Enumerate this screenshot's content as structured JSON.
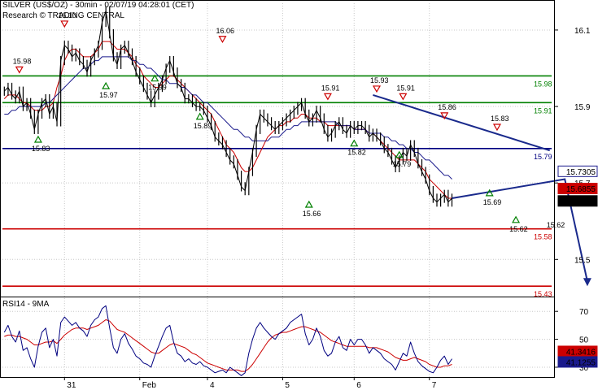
{
  "header": {
    "title": "SILVER (US$/OZ) - 30min - 02/07/19 04:28:01 (CET)",
    "research": "Research © TRADING CENTRAL"
  },
  "colors": {
    "price": "#000000",
    "ma_fast": "#cc0000",
    "ma_slow": "#1a1a8c",
    "support_resistance_green": "#008000",
    "pivot_blue": "#000080",
    "support_red": "#cc0000",
    "trend_arrow": "#1a2a8c",
    "rsi": "#000080",
    "rsi_ma": "#cc0000"
  },
  "chart_data": [
    {
      "type": "line",
      "panel": "price",
      "ylim": [
        15.405,
        16.17
      ],
      "yticks": [
        16.1,
        15.9,
        15.7,
        15.5
      ],
      "x_labels": [
        {
          "label": "31",
          "bar": 16
        },
        {
          "label": "Feb",
          "bar": 36
        },
        {
          "label": "4",
          "bar": 54
        },
        {
          "label": "5",
          "bar": 74
        },
        {
          "label": "6",
          "bar": 93
        },
        {
          "label": "7",
          "bar": 113
        }
      ],
      "bars_total": 146,
      "series": [
        {
          "role": "price",
          "values": [
            15.94,
            15.95,
            15.93,
            15.92,
            15.94,
            15.9,
            15.91,
            15.88,
            15.84,
            15.88,
            15.91,
            15.92,
            15.88,
            15.9,
            15.86,
            16.02,
            16.06,
            16.05,
            16.03,
            16.04,
            16.02,
            16.01,
            15.99,
            16.02,
            16.04,
            16.06,
            16.12,
            16.15,
            16.09,
            16.03,
            16.01,
            16.05,
            16.06,
            16.04,
            16.02,
            15.99,
            15.97,
            15.95,
            15.93,
            15.91,
            15.93,
            15.95,
            15.97,
            16.0,
            16.02,
            15.99,
            15.96,
            15.95,
            15.92,
            15.92,
            15.91,
            15.9,
            15.9,
            15.89,
            15.87,
            15.85,
            15.82,
            15.81,
            15.8,
            15.78,
            15.76,
            15.75,
            15.72,
            15.69,
            15.68,
            15.73,
            15.78,
            15.84,
            15.88,
            15.87,
            15.86,
            15.85,
            15.84,
            15.85,
            15.86,
            15.87,
            15.88,
            15.89,
            15.9,
            15.91,
            15.88,
            15.86,
            15.87,
            15.89,
            15.87,
            15.84,
            15.82,
            15.83,
            15.85,
            15.86,
            15.84,
            15.83,
            15.85,
            15.84,
            15.85,
            15.85,
            15.84,
            15.82,
            15.83,
            15.82,
            15.81,
            15.79,
            15.78,
            15.76,
            15.74,
            15.76,
            15.78,
            15.77,
            15.8,
            15.78,
            15.75,
            15.73,
            15.71,
            15.68,
            15.66,
            15.65,
            15.66,
            15.67,
            15.65,
            15.66
          ]
        },
        {
          "role": "ma_fast",
          "values": [
            15.92,
            15.93,
            15.93,
            15.93,
            15.92,
            15.91,
            15.91,
            15.9,
            15.89,
            15.89,
            15.89,
            15.9,
            15.9,
            15.91,
            15.95,
            15.98,
            16.02,
            16.04,
            16.05,
            16.05,
            16.04,
            16.03,
            16.03,
            16.03,
            16.04,
            16.05,
            16.07,
            16.07,
            16.07,
            16.06,
            16.05,
            16.05,
            16.05,
            16.04,
            16.03,
            16.01,
            16.0,
            15.98,
            15.97,
            15.96,
            15.95,
            15.95,
            15.96,
            15.97,
            15.98,
            15.98,
            15.97,
            15.96,
            15.95,
            15.94,
            15.93,
            15.92,
            15.91,
            15.9,
            15.89,
            15.88,
            15.86,
            15.84,
            15.82,
            15.8,
            15.79,
            15.78,
            15.76,
            15.74,
            15.73,
            15.73,
            15.74,
            15.76,
            15.78,
            15.8,
            15.82,
            15.83,
            15.84,
            15.85,
            15.85,
            15.86,
            15.86,
            15.87,
            15.87,
            15.88,
            15.88,
            15.87,
            15.87,
            15.87,
            15.86,
            15.86,
            15.85,
            15.85,
            15.85,
            15.85,
            15.85,
            15.85,
            15.85,
            15.84,
            15.84,
            15.84,
            15.84,
            15.83,
            15.83,
            15.82,
            15.81,
            15.8,
            15.79,
            15.78,
            15.77,
            15.76,
            15.76,
            15.76,
            15.76,
            15.76,
            15.75,
            15.74,
            15.73,
            15.71,
            15.7,
            15.69,
            15.68,
            15.67,
            15.66,
            15.66
          ]
        },
        {
          "role": "ma_slow",
          "values": [
            15.88,
            15.88,
            15.89,
            15.89,
            15.9,
            15.9,
            15.9,
            15.9,
            15.9,
            15.9,
            15.9,
            15.91,
            15.91,
            15.92,
            15.93,
            15.94,
            15.95,
            15.96,
            15.97,
            15.98,
            15.99,
            16.0,
            16.0,
            16.01,
            16.02,
            16.02,
            16.03,
            16.03,
            16.03,
            16.03,
            16.03,
            16.03,
            16.03,
            16.03,
            16.02,
            16.02,
            16.01,
            16.01,
            16.0,
            16.0,
            15.99,
            15.98,
            15.97,
            15.97,
            15.96,
            15.96,
            15.96,
            15.95,
            15.95,
            15.94,
            15.93,
            15.93,
            15.92,
            15.91,
            15.91,
            15.9,
            15.89,
            15.88,
            15.87,
            15.86,
            15.85,
            15.84,
            15.84,
            15.83,
            15.82,
            15.82,
            15.81,
            15.81,
            15.81,
            15.81,
            15.81,
            15.82,
            15.82,
            15.82,
            15.83,
            15.84,
            15.84,
            15.85,
            15.85,
            15.86,
            15.86,
            15.86,
            15.86,
            15.86,
            15.86,
            15.86,
            15.86,
            15.86,
            15.86,
            15.85,
            15.85,
            15.85,
            15.85,
            15.84,
            15.84,
            15.84,
            15.84,
            15.83,
            15.83,
            15.83,
            15.83,
            15.82,
            15.82,
            15.81,
            15.81,
            15.8,
            15.8,
            15.79,
            15.79,
            15.78,
            15.78,
            15.77,
            15.76,
            15.76,
            15.75,
            15.74,
            15.73,
            15.72,
            15.72,
            15.71
          ]
        }
      ],
      "horizontal_levels": [
        {
          "value": 15.98,
          "label": "15.98",
          "color": "#008000"
        },
        {
          "value": 15.91,
          "label": "15.91",
          "color": "#008000"
        },
        {
          "value": 15.79,
          "label": "15.79",
          "color": "#000080"
        },
        {
          "value": 15.58,
          "label": "15.58",
          "color": "#cc0000"
        },
        {
          "value": 15.43,
          "label": "15.43",
          "color": "#cc0000"
        }
      ],
      "price_tags": [
        {
          "value": 15.7305,
          "label": "15.7305",
          "bg": "#ffffff",
          "fg": "#1a1a8c",
          "border": "#1a1a8c"
        },
        {
          "value": 15.6855,
          "label": "15.6855",
          "bg": "#cc0000",
          "fg": "#ffffff",
          "border": "#cc0000"
        },
        {
          "value": 15.653,
          "label": "15.653",
          "bg": "#000000",
          "fg": "#ffffff",
          "border": "#000000"
        }
      ],
      "pivot_highs": [
        {
          "bar": 4,
          "value": 15.98,
          "label": "15.98"
        },
        {
          "bar": 16,
          "value": 16.1,
          "label": "16.10"
        },
        {
          "bar": 58,
          "value": 16.06,
          "label": "16.06"
        },
        {
          "bar": 86,
          "value": 15.91,
          "label": "15.91"
        },
        {
          "bar": 99,
          "value": 15.93,
          "label": "15.93"
        },
        {
          "bar": 106,
          "value": 15.91,
          "label": "15.91"
        },
        {
          "bar": 117,
          "value": 15.86,
          "label": "15.86"
        },
        {
          "bar": 131,
          "value": 15.83,
          "label": "15.83"
        }
      ],
      "pivot_lows": [
        {
          "bar": 9,
          "value": 15.83,
          "label": "15.83"
        },
        {
          "bar": 27,
          "value": 15.97,
          "label": "15.97"
        },
        {
          "bar": 40,
          "value": 15.99,
          "label": "15.99"
        },
        {
          "bar": 52,
          "value": 15.89,
          "label": "15.89"
        },
        {
          "bar": 81,
          "value": 15.66,
          "label": "15.66"
        },
        {
          "bar": 93,
          "value": 15.82,
          "label": "15.82"
        },
        {
          "bar": 105,
          "value": 15.79,
          "label": "15.79"
        },
        {
          "bar": 129,
          "value": 15.69,
          "label": "15.69"
        },
        {
          "bar": 136,
          "value": 15.62,
          "label": "15.62"
        }
      ],
      "extra_label": {
        "bar": 145,
        "value": 15.6,
        "label": "15.62"
      },
      "trendline": {
        "from": {
          "bar": 98,
          "value": 15.93
        },
        "to": {
          "bar": 145,
          "value": 15.785
        }
      },
      "projection_arrow": [
        {
          "bar": 149,
          "value": 15.71
        },
        {
          "bar": 155,
          "value": 15.43
        }
      ]
    },
    {
      "type": "line",
      "panel": "rsi",
      "title": "RSI14 - 9MA",
      "ylim": [
        23,
        80
      ],
      "yticks": [
        70,
        50,
        30
      ],
      "series": [
        {
          "role": "rsi",
          "values": [
            55,
            60,
            52,
            48,
            56,
            42,
            44,
            36,
            30,
            45,
            55,
            58,
            44,
            50,
            38,
            62,
            66,
            63,
            60,
            62,
            58,
            56,
            52,
            60,
            64,
            66,
            72,
            74,
            58,
            44,
            40,
            50,
            54,
            47,
            43,
            38,
            36,
            33,
            32,
            30,
            38,
            45,
            52,
            58,
            60,
            48,
            40,
            38,
            34,
            36,
            33,
            32,
            34,
            31,
            30,
            28,
            26,
            27,
            28,
            26,
            30,
            28,
            26,
            24,
            26,
            40,
            50,
            58,
            62,
            58,
            55,
            52,
            50,
            54,
            56,
            58,
            62,
            64,
            66,
            68,
            54,
            46,
            50,
            58,
            52,
            42,
            38,
            40,
            48,
            52,
            44,
            42,
            50,
            46,
            50,
            50,
            46,
            40,
            44,
            42,
            40,
            36,
            34,
            32,
            28,
            34,
            40,
            38,
            48,
            40,
            34,
            31,
            29,
            27,
            26,
            30,
            35,
            38,
            32,
            36
          ]
        },
        {
          "role": "rsi_ma",
          "values": [
            52,
            53,
            53,
            52,
            52,
            51,
            50,
            48,
            46,
            46,
            47,
            48,
            48,
            49,
            47,
            50,
            53,
            55,
            57,
            58,
            58,
            58,
            57,
            58,
            59,
            60,
            62,
            64,
            63,
            60,
            57,
            56,
            55,
            53,
            51,
            49,
            47,
            45,
            43,
            41,
            40,
            40,
            42,
            44,
            46,
            47,
            46,
            45,
            44,
            42,
            40,
            39,
            37,
            35,
            33,
            32,
            31,
            30,
            29,
            28,
            28,
            28,
            28,
            27,
            27,
            29,
            32,
            36,
            40,
            44,
            48,
            51,
            53,
            54,
            55,
            55,
            56,
            57,
            58,
            59,
            59,
            58,
            57,
            56,
            55,
            53,
            51,
            49,
            48,
            47,
            46,
            45,
            45,
            45,
            45,
            45,
            45,
            44,
            44,
            44,
            43,
            42,
            41,
            39,
            37,
            36,
            35,
            35,
            36,
            37,
            36,
            35,
            34,
            32,
            31,
            30,
            30,
            31,
            31,
            32
          ]
        }
      ],
      "price_tags": [
        {
          "value": 41.3416,
          "label": "41.3416",
          "bg": "#cc0000",
          "fg": "#ffffff",
          "border": "#cc0000"
        },
        {
          "value": 41.1255,
          "label": "41.1255",
          "bg": "#1a1a8c",
          "fg": "#ffffff",
          "border": "#1a1a8c"
        }
      ]
    }
  ]
}
